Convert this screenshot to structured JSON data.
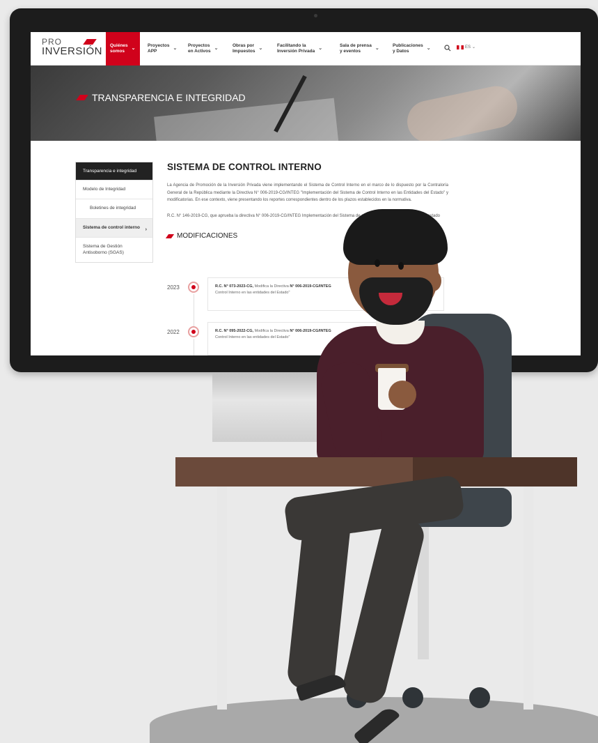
{
  "nav": {
    "logo_line1": "PRO",
    "logo_line2": "INVERSIÓN",
    "items": [
      {
        "label": "Quiénes\nsomos",
        "active": true
      },
      {
        "label": "Proyectos\nAPP"
      },
      {
        "label": "Proyectos\nen Activos"
      },
      {
        "label": "Obras por\nImpuestos"
      },
      {
        "label": "Facilitando la\nInversión Privada"
      },
      {
        "label": "Sala de prensa\ny eventos"
      },
      {
        "label": "Publicaciones\ny Datos"
      }
    ],
    "search_icon": "search-icon",
    "language": "ES"
  },
  "hero": {
    "title": "TRANSPARENCIA E INTEGRIDAD"
  },
  "sidebar": {
    "header": "Transparencia e integridad",
    "items": [
      {
        "label": "Modelo de Integridad"
      },
      {
        "label": "Boletines de integridad",
        "sub": true
      },
      {
        "label": "Sistema de control interno",
        "active": true
      },
      {
        "label": "Sistema de Gestión Antisoborno (SGAS)"
      }
    ]
  },
  "content": {
    "title": "SISTEMA DE CONTROL INTERNO",
    "paragraph1": "La Agencia de Promoción de la Inversión Privada viene implementando el Sistema de Control Interno en el marco de lo dispuesto por la Contraloría General de la República mediante la Directiva N° 006-2019-CG/INTEG \"Implementación del Sistema de Control Interno en las Entidades del Estado\" y modificatorias. En ese contexto, viene presentando los reportes correspondientes dentro de los plazos establecidos en la normativa.",
    "paragraph2": "R.C. N° 146-2019-CG, que aprueba la directiva N° 006-2019-CG/INTEG Implementación del Sistema de control interno en las entidades del estado",
    "section_title": "MODIFICACIONES",
    "timeline": [
      {
        "year": "2023",
        "ref": "R.C. N° 073-2023-CG,",
        "text": "Modifica la Directiva",
        "ref2": "N° 006-2019-CG/INTEG",
        "tail": "Control Interno en las entidades del Estado\""
      },
      {
        "year": "2022",
        "ref": "R.C. N° 095-2022-CG,",
        "text": "Modifica la Directiva",
        "ref2": "N° 006-2019-CG/INTEG",
        "tail": "Control Interno en las entidades del Estado\""
      }
    ]
  },
  "colors": {
    "brand_red": "#d0021b",
    "sidebar_header": "#222222",
    "desk": "#6b4a3b",
    "sweater": "#4a1f2b"
  }
}
